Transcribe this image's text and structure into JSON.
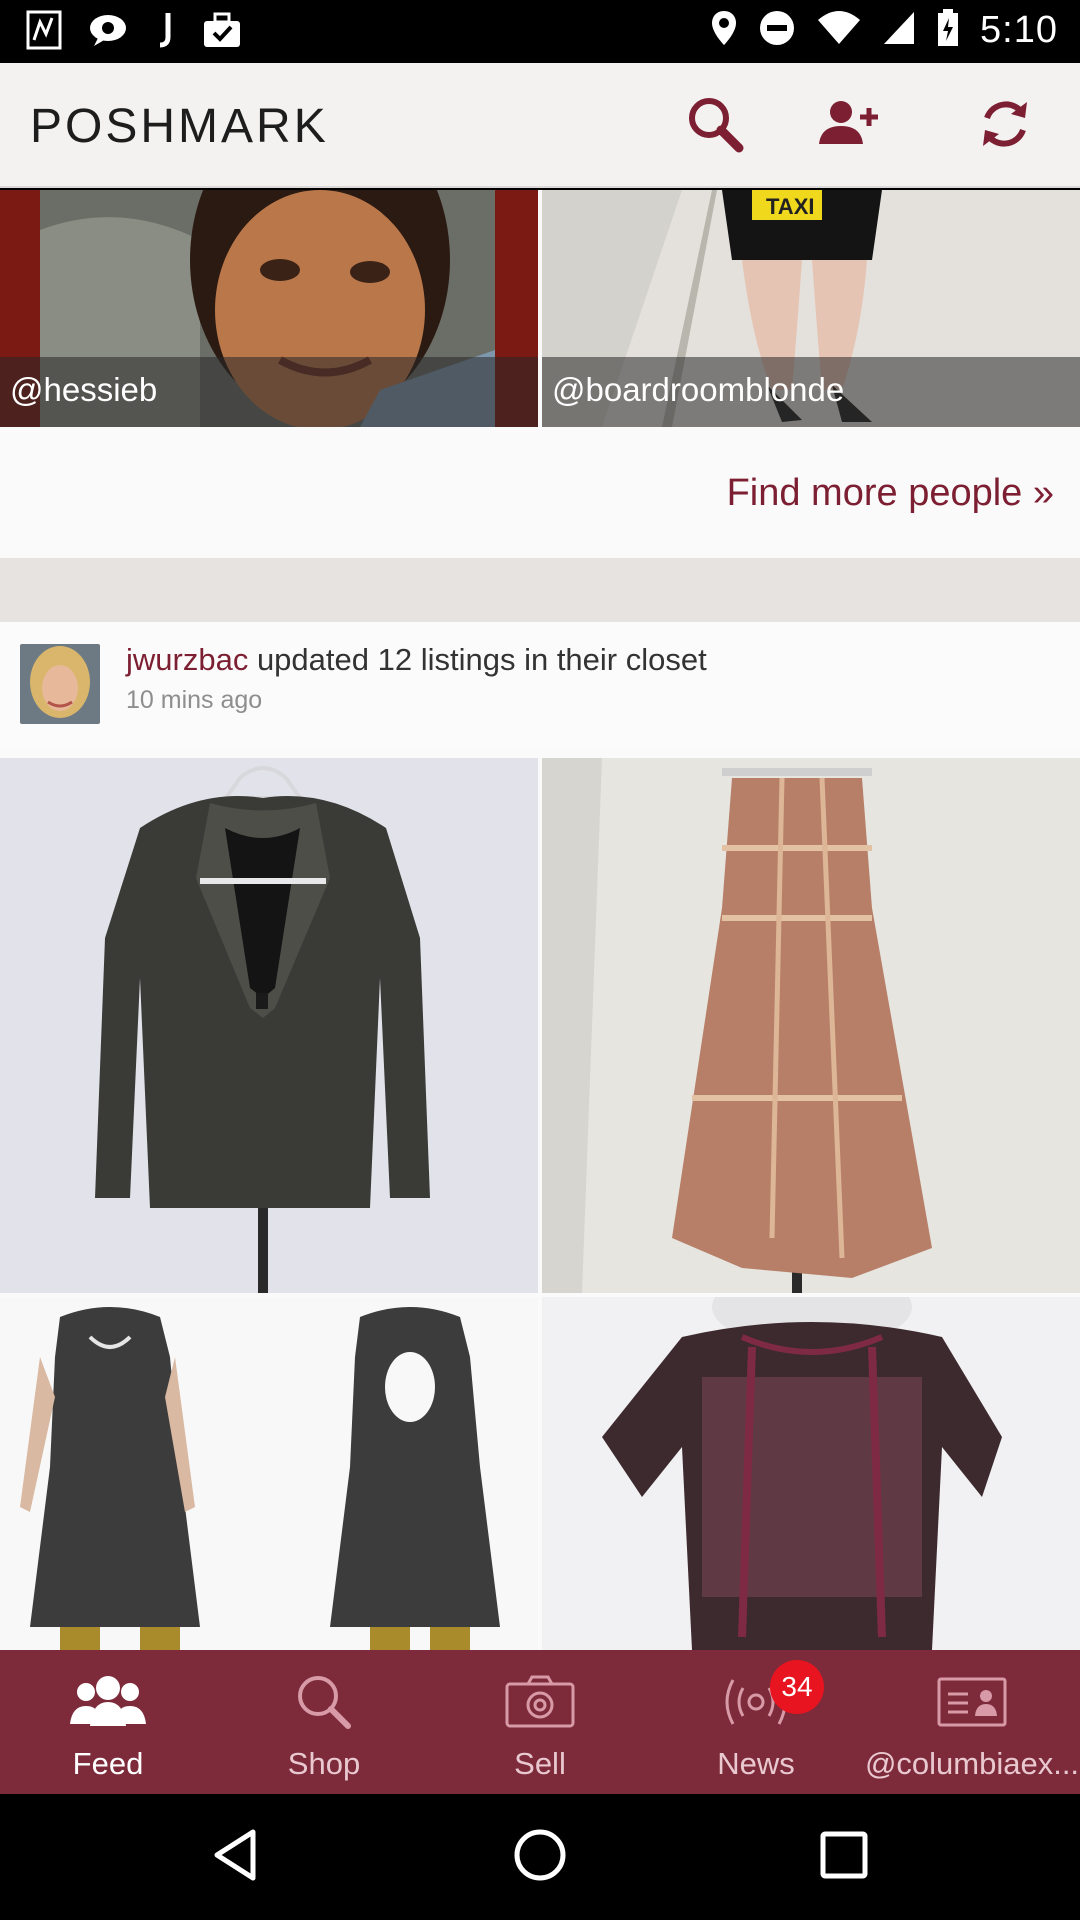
{
  "status_bar": {
    "time": "5:10",
    "left_icons": [
      "photo-app-icon",
      "chat-bubble-icon",
      "j-app-icon",
      "briefcase-check-icon"
    ],
    "right_icons": [
      "location-icon",
      "do-not-disturb-icon",
      "wifi-icon",
      "cell-signal-icon",
      "battery-charging-icon"
    ]
  },
  "header": {
    "logo": "POSHMARK",
    "actions": [
      "search-icon",
      "add-user-icon",
      "refresh-icon"
    ],
    "accent": "#7d1f32"
  },
  "people": [
    {
      "handle": "@hessieb"
    },
    {
      "handle": "@boardroomblonde"
    }
  ],
  "find_more": "Find more people »",
  "feed_item": {
    "user": "jwurzbac",
    "action": " updated 12 listings in their closet",
    "time": "10 mins ago"
  },
  "listings": [
    {
      "name": "dark-knit-cardigan"
    },
    {
      "name": "pink-strapless-dress"
    },
    {
      "name": "patterned-dress"
    },
    {
      "name": "lace-top"
    }
  ],
  "bottom_nav": {
    "items": [
      {
        "label": "Feed",
        "icon": "people-icon",
        "active": true
      },
      {
        "label": "Shop",
        "icon": "search-icon"
      },
      {
        "label": "Sell",
        "icon": "camera-icon"
      },
      {
        "label": "News",
        "icon": "broadcast-icon",
        "badge": "34"
      },
      {
        "label": "@columbiaex...",
        "icon": "profile-card-icon"
      }
    ],
    "background": "#7d2b3b"
  },
  "system_nav": [
    "back-icon",
    "home-icon",
    "recents-icon"
  ]
}
